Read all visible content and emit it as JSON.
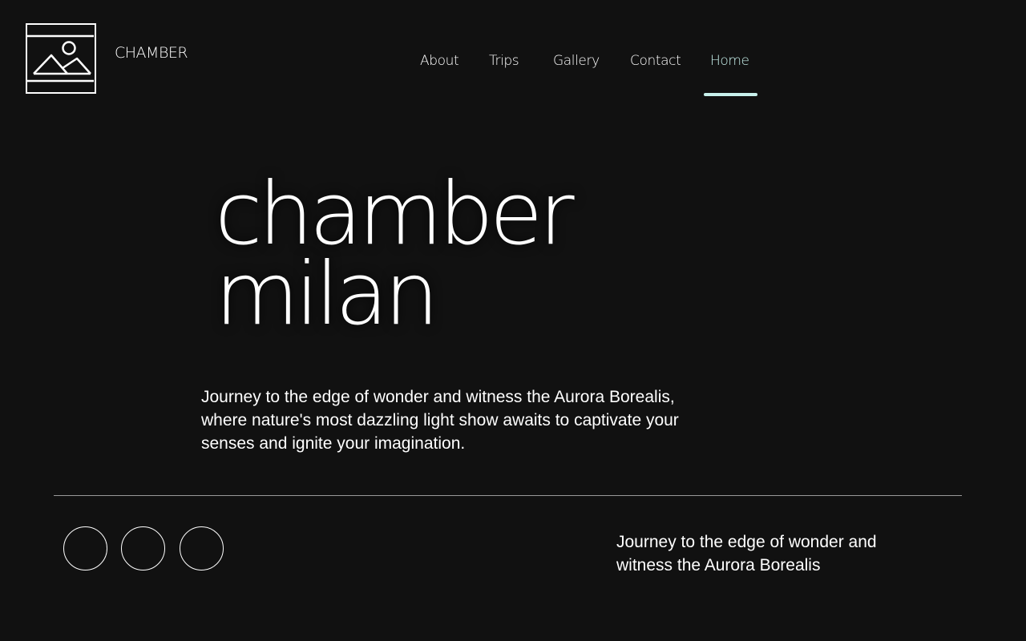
{
  "header": {
    "brand_name": "CHAMBER",
    "logo_icon": "image-placeholder-icon"
  },
  "nav": {
    "items": [
      {
        "label": "About",
        "active": false
      },
      {
        "label": "Trips",
        "active": false
      },
      {
        "label": "Gallery",
        "active": false
      },
      {
        "label": "Contact",
        "active": false
      },
      {
        "label": "Home",
        "active": true
      }
    ]
  },
  "hero": {
    "title_line1": "chamber",
    "title_line2": "milan",
    "description": "Journey to the edge of wonder and witness the Aurora Borealis, where nature's most dazzling light show awaits to captivate your senses and ignite your imagination."
  },
  "footer": {
    "tagline": "Journey to the edge of wonder and witness the Aurora Borealis",
    "social_buttons": [
      "circle-button-1",
      "circle-button-2",
      "circle-button-3"
    ]
  },
  "colors": {
    "background": "#111111",
    "text": "#ffffff",
    "accent": "#c8f1ec",
    "divider": "#9a9a9a"
  }
}
